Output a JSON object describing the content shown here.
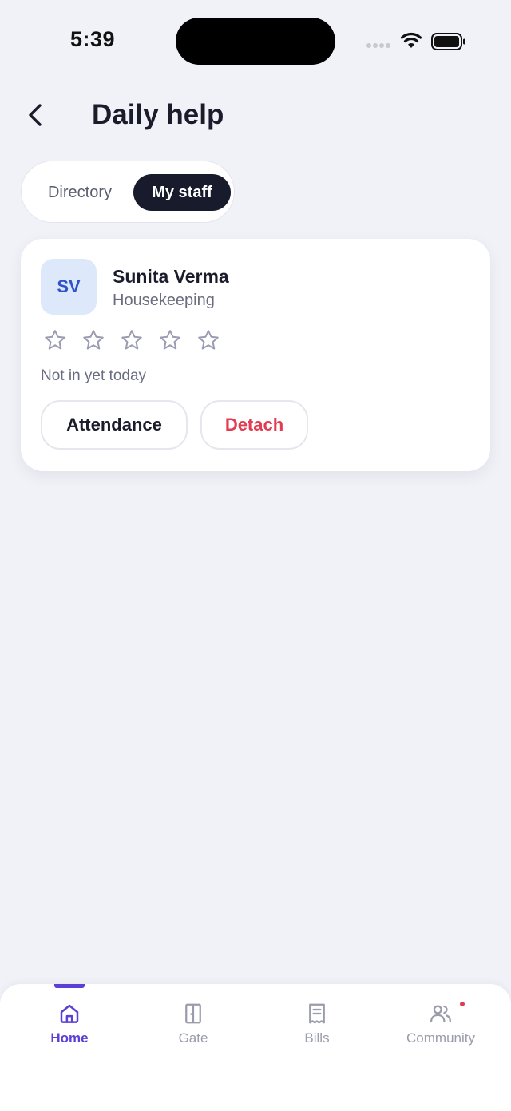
{
  "status_bar": {
    "time": "5:39"
  },
  "header": {
    "title": "Daily help"
  },
  "segments": [
    {
      "label": "Directory",
      "active": false
    },
    {
      "label": "My staff",
      "active": true
    }
  ],
  "staff_card": {
    "initials": "SV",
    "name": "Sunita Verma",
    "role": "Housekeeping",
    "rating": 0,
    "max_rating": 5,
    "status": "Not in yet today",
    "attendance_label": "Attendance",
    "detach_label": "Detach"
  },
  "tab_bar": {
    "items": [
      {
        "label": "Home",
        "icon": "home-icon",
        "active": true
      },
      {
        "label": "Gate",
        "icon": "door-icon",
        "active": false
      },
      {
        "label": "Bills",
        "icon": "receipt-icon",
        "active": false
      },
      {
        "label": "Community",
        "icon": "people-icon",
        "active": false,
        "badge": true
      }
    ]
  },
  "colors": {
    "accent": "#5b3fd6",
    "danger": "#e23c52",
    "dark_pill": "#181b2b",
    "avatar_bg": "#dde8fb",
    "avatar_text": "#2e55c8",
    "background": "#f1f2f8"
  }
}
